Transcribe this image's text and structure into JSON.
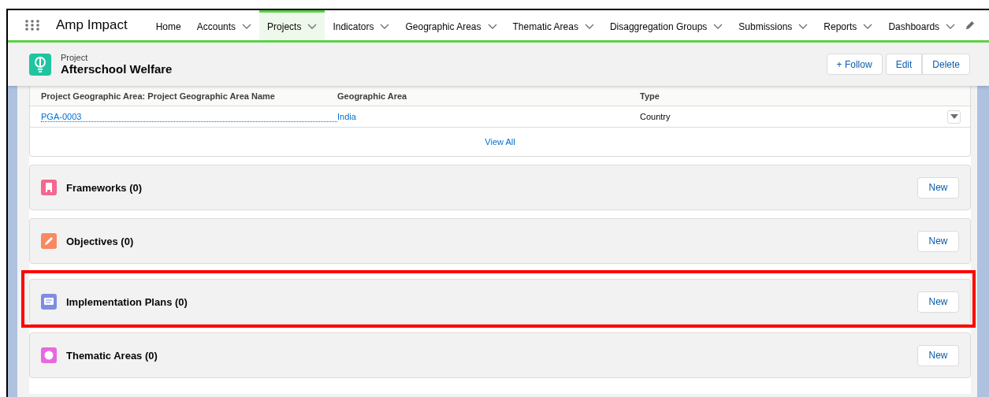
{
  "app": {
    "name": "Amp Impact"
  },
  "nav": [
    {
      "label": "Home",
      "has_menu": false,
      "selected": false
    },
    {
      "label": "Accounts",
      "has_menu": true,
      "selected": false
    },
    {
      "label": "Projects",
      "has_menu": true,
      "selected": true
    },
    {
      "label": "Indicators",
      "has_menu": true,
      "selected": false
    },
    {
      "label": "Geographic Areas",
      "has_menu": true,
      "selected": false
    },
    {
      "label": "Thematic Areas",
      "has_menu": true,
      "selected": false
    },
    {
      "label": "Disaggregation Groups",
      "has_menu": true,
      "selected": false
    },
    {
      "label": "Submissions",
      "has_menu": true,
      "selected": false
    },
    {
      "label": "Reports",
      "has_menu": true,
      "selected": false
    },
    {
      "label": "Dashboards",
      "has_menu": true,
      "selected": false
    }
  ],
  "record": {
    "type": "Project",
    "name": "Afterschool Welfare",
    "actions": [
      {
        "label": "+ Follow",
        "kind": "follow"
      },
      {
        "label": "Edit",
        "kind": "plain"
      },
      {
        "label": "Delete",
        "kind": "plain"
      }
    ]
  },
  "table": {
    "columns": [
      "Project Geographic Area: Project Geographic Area Name",
      "Geographic Area",
      "Type"
    ],
    "rows": [
      {
        "cells": [
          "PGA-0003",
          "India",
          "Country"
        ]
      }
    ],
    "view_all": "View All"
  },
  "sections": [
    {
      "title": "Frameworks (0)",
      "kind": "building",
      "color": "#f26891",
      "button": "New",
      "highlighted": false
    },
    {
      "title": "Objectives (0)",
      "kind": "pencil",
      "color": "#f88962",
      "button": "New",
      "highlighted": false
    },
    {
      "title": "Implementation Plans (0)",
      "kind": "screen",
      "color": "#7f8de1",
      "button": "New",
      "highlighted": true
    },
    {
      "title": "Thematic Areas (0)",
      "kind": "circle",
      "color": "#e769e0",
      "button": "New",
      "highlighted": false
    }
  ]
}
